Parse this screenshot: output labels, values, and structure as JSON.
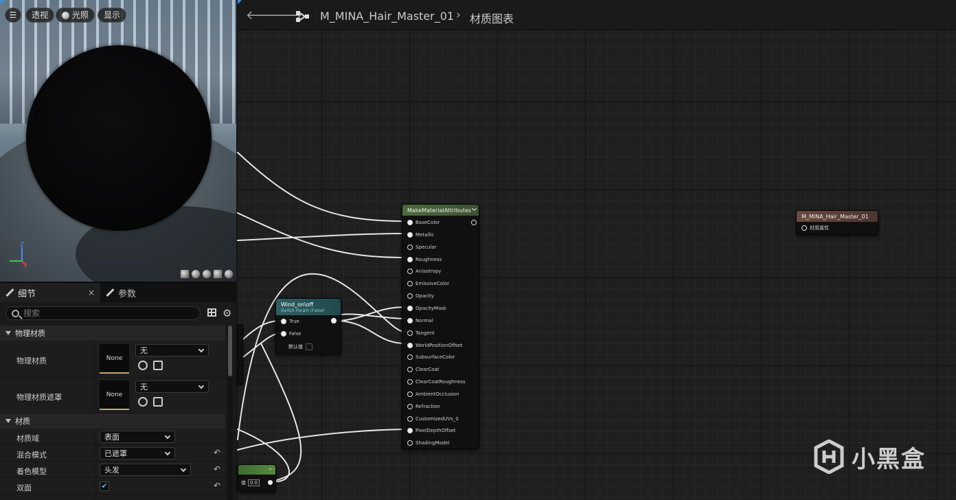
{
  "viewport": {
    "buttons": {
      "perspective": "透视",
      "lighting": "光照",
      "show": "显示"
    },
    "axes": {
      "z": "Z",
      "y": "Y",
      "x": "X"
    }
  },
  "details": {
    "tabs": [
      {
        "label": "细节",
        "close": "×"
      },
      {
        "label": "参数"
      }
    ],
    "search_placeholder": "搜索",
    "sections": [
      {
        "title": "物理材质"
      },
      {
        "title": "材质"
      }
    ],
    "phys_material": {
      "label": "物理材质",
      "thumb": "None",
      "combo": "无"
    },
    "phys_mask": {
      "label": "物理材质遮罩",
      "thumb": "None",
      "combo": "无"
    },
    "material_domain": {
      "label": "材质域",
      "value": "表面"
    },
    "blend_mode": {
      "label": "混合模式",
      "value": "已遮罩"
    },
    "shading_model": {
      "label": "着色模型",
      "value": "头发"
    },
    "two_sided": {
      "label": "双面",
      "checked": true
    }
  },
  "toolbar": {
    "back_icon": "arrow-left-icon",
    "forward_icon": "arrow-right-icon",
    "breadcrumb_asset": "M_MINA_Hair_Master_01",
    "breadcrumb_separator": "›",
    "breadcrumb_graph": "材质图表"
  },
  "graph": {
    "make_material_attributes": {
      "title": "MakeMaterialAttributes",
      "pins": [
        "BaseColor",
        "Metallic",
        "Specular",
        "Roughness",
        "Anisotropy",
        "EmissiveColor",
        "Opacity",
        "OpacityMask",
        "Normal",
        "Tangent",
        "WorldPositionOffset",
        "SubsurfaceColor",
        "ClearCoat",
        "ClearCoatRoughness",
        "AmbientOcclusion",
        "Refraction",
        "CustomizedUVs_0",
        "PixelDepthOffset",
        "ShadingModel"
      ]
    },
    "wind_switch": {
      "title": "Wind_on\\off",
      "subtitle": "Switch Param (False)",
      "pin_true": "True",
      "pin_false": "False",
      "default_label": "默认值"
    },
    "result_node": {
      "title": "M_MINA_Hair_Master_01",
      "pin": "材质属性"
    },
    "partial_node": {
      "value_label": "值",
      "value": "0.0"
    }
  },
  "watermark": {
    "text": "小黑盒"
  },
  "colors": {
    "accent_blue": "#3a8ee6",
    "node_mma_header": "#4e6b3d",
    "node_switch_header": "#2f5f63",
    "node_result_header": "#6a4a40"
  }
}
